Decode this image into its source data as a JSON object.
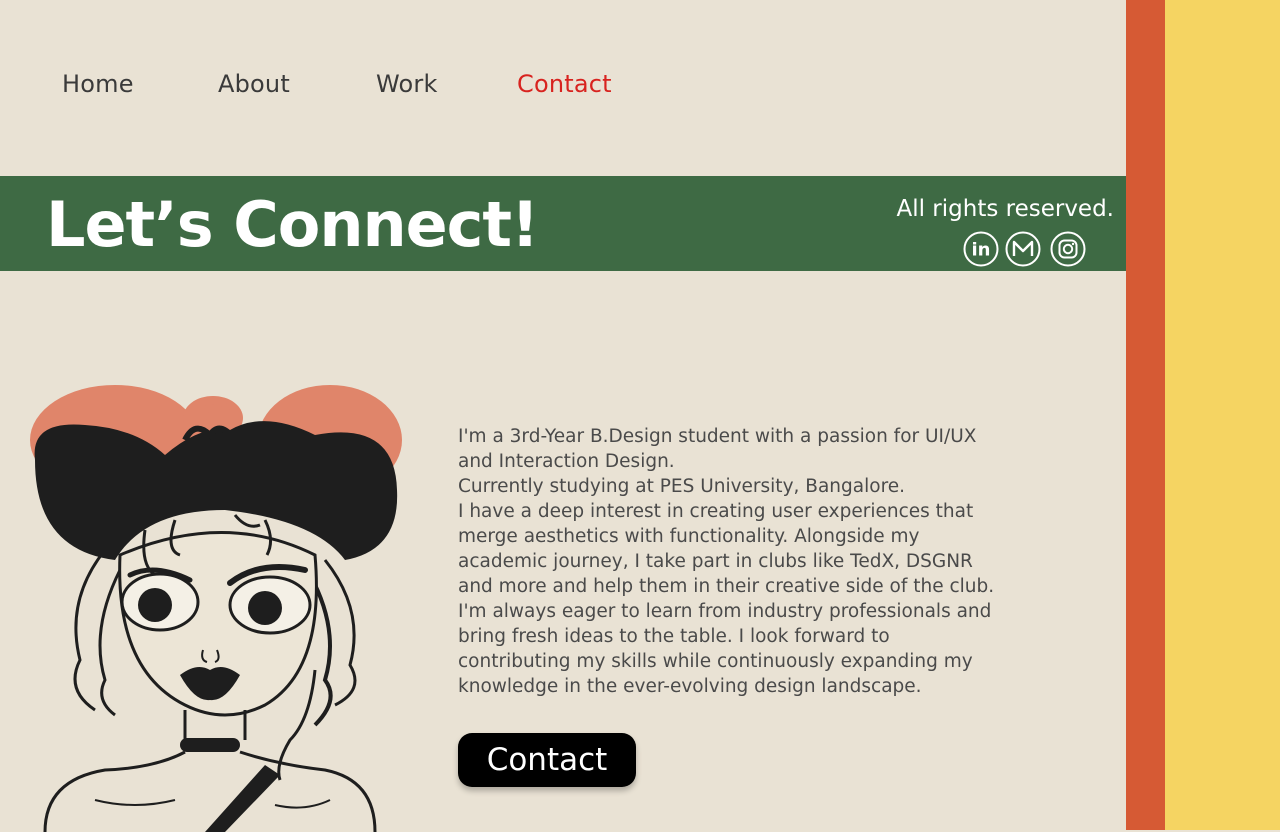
{
  "nav": {
    "items": [
      {
        "label": "Home"
      },
      {
        "label": "About"
      },
      {
        "label": "Work"
      },
      {
        "label": "Contact"
      }
    ],
    "active_index": 3,
    "active_color": "#d8231f"
  },
  "banner": {
    "title": "Let’s Connect!",
    "rights": "All rights reserved.",
    "socials": [
      {
        "icon": "linkedin-icon",
        "glyph": "in"
      },
      {
        "icon": "gmail-icon",
        "glyph": "M"
      },
      {
        "icon": "instagram-icon"
      }
    ]
  },
  "bio": {
    "paragraphs": [
      "I'm a 3rd-Year B.Design student with a passion for UI/UX and Interaction Design.",
      "Currently studying at PES University, Bangalore.",
      "I have a deep interest in creating user experiences that merge aesthetics with functionality. Alongside my academic journey, I take part in clubs like TedX, DSGNR and more and help them in their creative side of the club. I'm always eager to learn from industry professionals and bring fresh ideas to the table. I look forward to contributing my skills while continuously expanding my knowledge in the ever-evolving design landscape."
    ]
  },
  "cta": {
    "label": "Contact"
  },
  "colors": {
    "background": "#e9e2d4",
    "banner": "#3e6a44",
    "stripe_orange": "#d65a34",
    "stripe_yellow": "#f5d462",
    "button": "#000000"
  }
}
